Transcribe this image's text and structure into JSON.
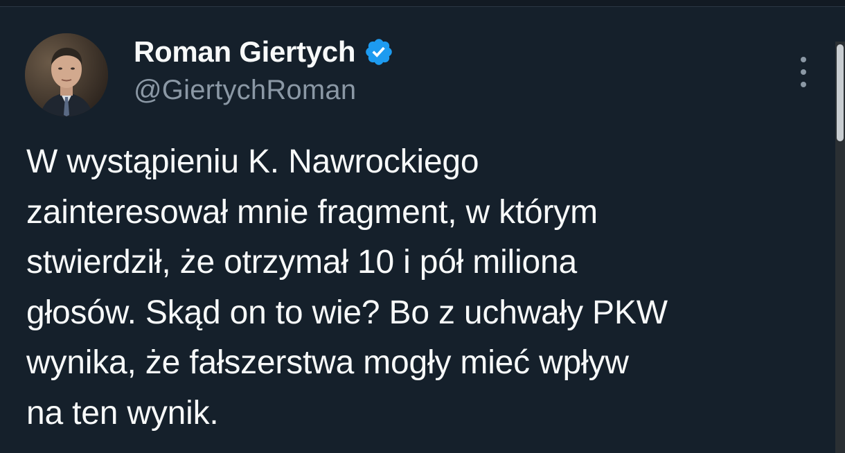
{
  "author": {
    "display_name": "Roman Giertych",
    "handle": "@GiertychRoman",
    "verified": true,
    "verified_color": "#1d9bf0",
    "avatar_icon": "user-avatar"
  },
  "menu": {
    "more_icon": "more-vertical-icon"
  },
  "tweet": {
    "lines": [
      "W wystąpieniu K. Nawrockiego",
      "zainteresował mnie fragment, w którym",
      "stwierdził, że otrzymał 10 i pół miliona",
      "głosów. Skąd on to wie? Bo z uchwały PKW",
      "wynika, że fałszerstwa mogły mieć wpływ",
      "na ten wynik."
    ]
  },
  "theme": {
    "background": "#15202b",
    "text_primary": "#f7f9f9",
    "text_secondary": "#8b98a5"
  }
}
